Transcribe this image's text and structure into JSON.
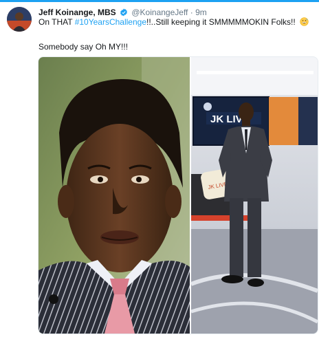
{
  "tweet": {
    "author_name": "Jeff Koinange, MBS",
    "handle": "@KoinangeJeff",
    "separator": "·",
    "time": "9m",
    "text_prefix": "On THAT ",
    "hashtag": "#10YearsChallenge",
    "text_suffix": "!!..Still keeping it SMMMMMOKIN Folks!!",
    "emoji": "grinning-sweat-emoji",
    "second_line": "Somebody say Oh MY!!!",
    "media": {
      "left_image": "portrait-photo-older",
      "right_image": "studio-photo-recent",
      "studio_screen_text": "JK LIVE",
      "pillow_text": "JK LIVE"
    }
  },
  "colors": {
    "accent": "#1da1f2",
    "secondary_text": "#657786",
    "primary_text": "#14171a"
  }
}
